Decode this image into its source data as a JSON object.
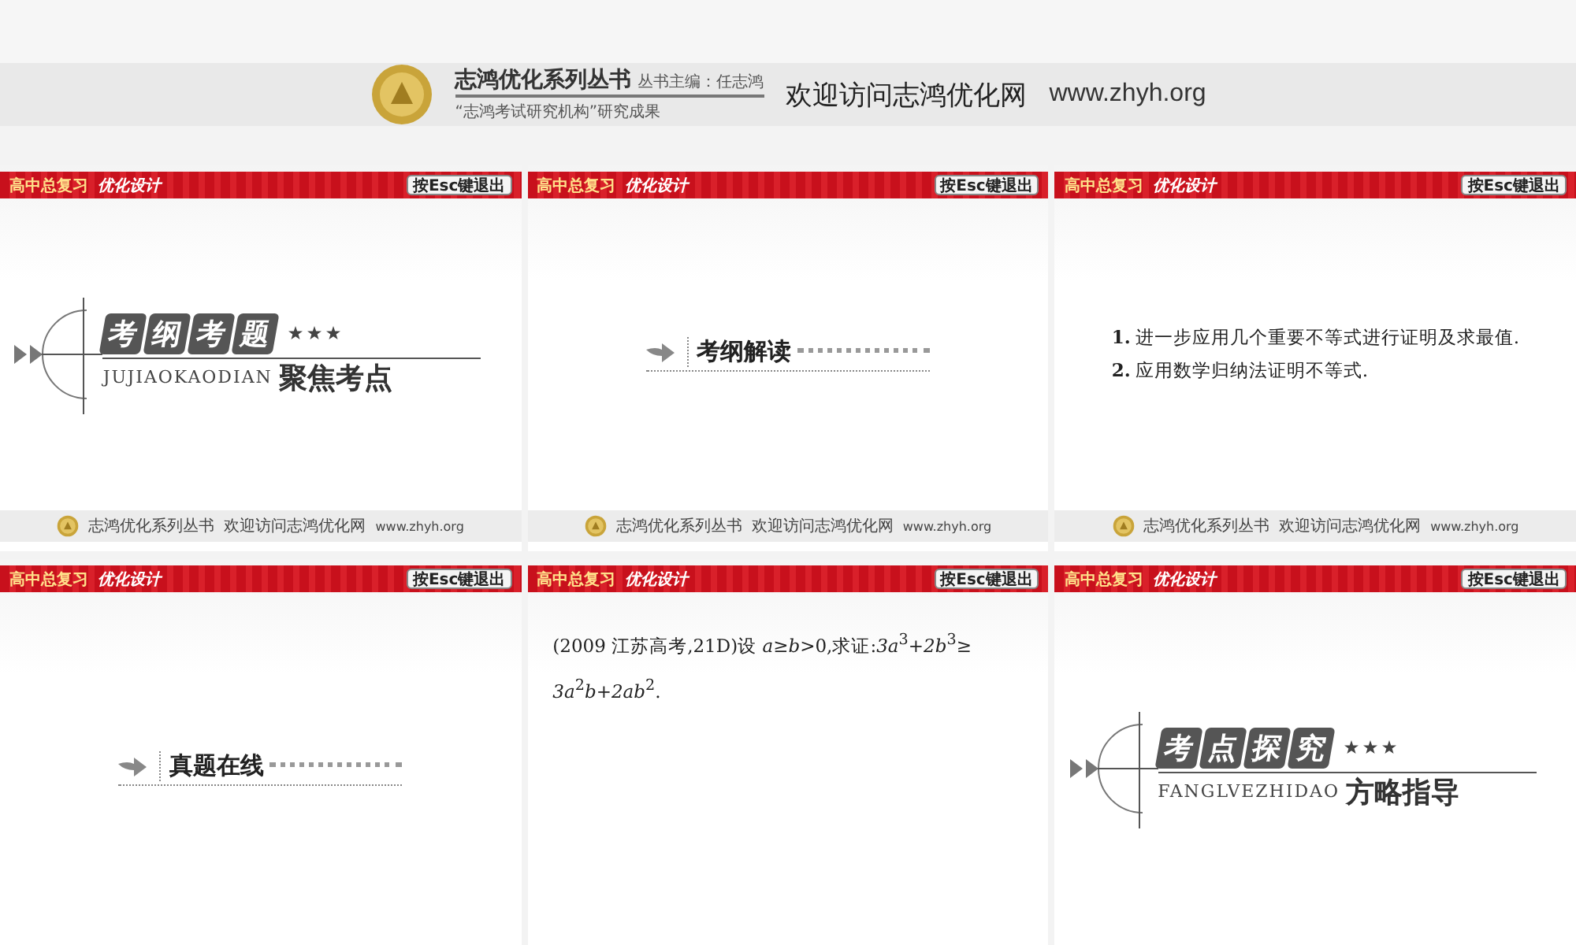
{
  "header": {
    "series_title": "志鸿优化系列丛书",
    "editor": "丛书主编：任志鸿",
    "subtitle": "“志鸿考试研究机构”研究成果",
    "welcome": "欢迎访问志鸿优化网",
    "url": "www.zhyh.org"
  },
  "slides": [
    {
      "kind": "section",
      "bar": {
        "course": "高中总复习",
        "brand": "优化设计",
        "exit": "按Esc键退出"
      },
      "chars": [
        "考",
        "纲",
        "考",
        "题"
      ],
      "stars": 3,
      "pinyin": "JUJIAOKAODIAN",
      "subtitle": "聚焦考点",
      "footer": {
        "series_title": "志鸿优化系列丛书",
        "welcome": "欢迎访问志鸿优化网",
        "url": "www.zhyh.org"
      }
    },
    {
      "kind": "heading",
      "bar": {
        "course": "高中总复习",
        "brand": "优化设计",
        "exit": "按Esc键退出"
      },
      "title": "考纲解读",
      "footer": {
        "series_title": "志鸿优化系列丛书",
        "welcome": "欢迎访问志鸿优化网",
        "url": "www.zhyh.org"
      }
    },
    {
      "kind": "list",
      "bar": {
        "course": "高中总复习",
        "brand": "优化设计",
        "exit": "按Esc键退出"
      },
      "items": [
        {
          "number": "1.",
          "text": "进一步应用几个重要不等式进行证明及求最值."
        },
        {
          "number": "2.",
          "text": "应用数学归纳法证明不等式."
        }
      ],
      "footer": {
        "series_title": "志鸿优化系列丛书",
        "welcome": "欢迎访问志鸿优化网",
        "url": "www.zhyh.org"
      }
    },
    {
      "kind": "heading",
      "bar": {
        "course": "高中总复习",
        "brand": "优化设计",
        "exit": "按Esc键退出"
      },
      "title": "真题在线"
    },
    {
      "kind": "problem",
      "bar": {
        "course": "高中总复习",
        "brand": "优化设计",
        "exit": "按Esc键退出"
      },
      "lines": [
        "(2009 江苏高考,21D)设 *a*≥*b*>0,求证:*3a*$^{3}$+*2b*$^{3}$≥",
        "*3a*$^{2}$*b*+*2ab*$^{2}$."
      ]
    },
    {
      "kind": "section",
      "bar": {
        "course": "高中总复习",
        "brand": "优化设计",
        "exit": "按Esc键退出"
      },
      "chars": [
        "考",
        "点",
        "探",
        "究"
      ],
      "stars": 3,
      "pinyin": "FANGLVEZHIDAO",
      "subtitle": "方略指导"
    }
  ]
}
